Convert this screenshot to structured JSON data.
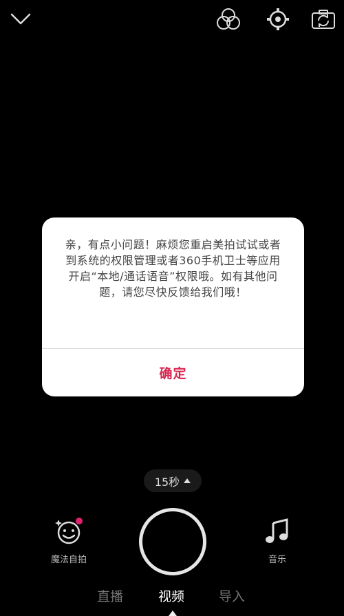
{
  "top_bar": {
    "icons": [
      "chevron-down-icon",
      "filters-icon",
      "settings-icon",
      "camera-flip-icon"
    ]
  },
  "dialog": {
    "message": "亲，有点小问题！麻烦您重启美拍试试或者到系统的权限管理或者360手机卫士等应用开启“本地/通话语音”权限哦。如有其他问题，请您尽快反馈给我们哦！",
    "confirm_label": "确定",
    "confirm_color": "#d6264f"
  },
  "recorder": {
    "duration_label": "15秒",
    "magic_label": "魔法自拍",
    "music_label": "音乐",
    "badge_color": "#e0226e"
  },
  "modes": {
    "tabs": [
      "直播",
      "视频",
      "导入"
    ],
    "active": "视频"
  }
}
